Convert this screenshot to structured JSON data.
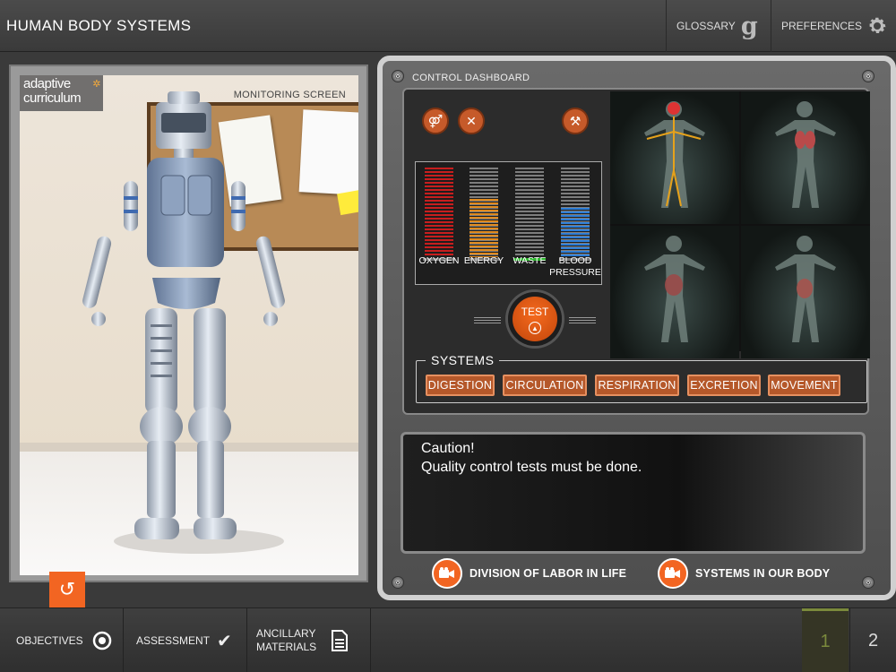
{
  "header": {
    "title": "HUMAN BODY SYSTEMS",
    "glossary_label": "GLOSSARY",
    "preferences_label": "PREFERENCES"
  },
  "monitor": {
    "label": "MONITORING SCREEN",
    "logo_line1": "adaptive",
    "logo_line2": "curriculum"
  },
  "dashboard": {
    "title": "CONTROL DASHBOARD",
    "gauges": [
      {
        "label": "OXYGEN",
        "level": 1.0,
        "color": "#c81e1e"
      },
      {
        "label": "ENERGY",
        "level": 0.65,
        "color": "#e08a1e"
      },
      {
        "label": "WASTE",
        "level": 0.0,
        "color": "#2db82d"
      },
      {
        "label": "BLOOD PRESSURE",
        "level": 0.55,
        "color": "#2f7fd8"
      }
    ],
    "test_label": "TEST",
    "systems_label": "SYSTEMS",
    "systems": [
      "DIGESTION",
      "CIRCULATION",
      "RESPIRATION",
      "EXCRETION",
      "MOVEMENT"
    ],
    "message_line1": "Caution!",
    "message_line2": "Quality control tests must be done.",
    "video_links": [
      "DIVISION OF LABOR IN LIFE",
      "SYSTEMS IN OUR BODY"
    ]
  },
  "footer": {
    "objectives_label": "OBJECTIVES",
    "assessment_label": "ASSESSMENT",
    "ancillary_line1": "ANCILLARY",
    "ancillary_line2": "MATERIALS",
    "pages": [
      "1",
      "2"
    ],
    "current_page": "1"
  }
}
